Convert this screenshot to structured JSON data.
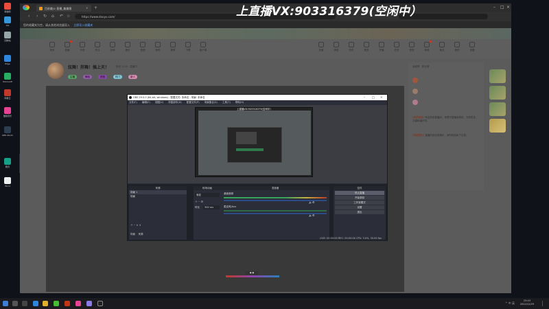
{
  "caption": "上直播VX:903316379(空闲中）",
  "desktop": {
    "icons": [
      "韩惯吧",
      "QQ",
      "回收站",
      "Edge",
      "Microsoft",
      "网易云",
      "酷我音乐",
      "OBS Studio",
      "腾讯",
      "Word"
    ]
  },
  "browser": {
    "tab_title": "目前最火·直播_美美眼",
    "url": "https://www.douyu.com/",
    "search_placeholder": "",
    "bookmarks": [
      "您的收藏夹为空，请从其他浏览器导入",
      "立即导入收藏夹"
    ]
  },
  "site": {
    "nav_items": [
      "首页",
      "直播",
      "分类",
      "关注",
      "游戏",
      "娱乐",
      "视频",
      "鱼吧",
      "赛事",
      "下载",
      "客户端",
      "充值",
      "消息",
      "历史",
      "更多",
      "开播",
      "任务",
      "签到",
      "商城",
      "鱼丸",
      "我的",
      "设置"
    ],
    "streamer": {
      "name": "炫舞！拌舞！搞上天！",
      "sub": "粉丝 1234  ·  直播中",
      "tags": [
        "主播",
        "舞蹈",
        "颜值",
        "热门",
        "新人"
      ]
    },
    "right_panel": {
      "rank": [
        "贡献榜",
        "粉丝榜"
      ],
      "chat": [
        {
          "user": "[系统消息]",
          "text": "欢迎来到直播间，请遵守直播间规则，文明发言，共建和谐环境。"
        },
        {
          "user": "[系统提示]",
          "text": "直播内容仅供娱乐，请勿轻信私下交易。"
        }
      ]
    }
  },
  "obs": {
    "title": "OBS 29.0.0 (64-bit, windows) - 配置文件: 未命名 - 场景: 未命名",
    "menu": [
      "文件(F)",
      "编辑(E)",
      "视图(V)",
      "停靠部件(D)",
      "配置文件(P)",
      "场景集合(S)",
      "工具(T)",
      "帮助(H)"
    ],
    "preview_caption": "上直播VX:903316379(空闲中）",
    "docks": {
      "scenes_header": "场景",
      "sources_header": "来源",
      "mixer_header": "混音器",
      "transitions_header": "转场动画",
      "controls_header": "控件",
      "scenes": [
        "场景 1",
        "场景"
      ],
      "transition_value": "渐变",
      "duration_label": "时长",
      "duration_value": "300 ms",
      "mixer_tracks": [
        "桌面音频",
        "麦克风/Aux"
      ],
      "controls": [
        "停止直播",
        "开始录制",
        "工作室模式",
        "设置",
        "退出"
      ],
      "bottom_tabs": [
        "场景",
        "来源"
      ]
    },
    "status": "LIVE: 00:00:00    REC: 00:00:00    CPU: 3.0%, 30.00 fps"
  },
  "taskbar": {
    "time": "23:43",
    "date": "2022/12/29",
    "tray": "^ 中 英"
  }
}
